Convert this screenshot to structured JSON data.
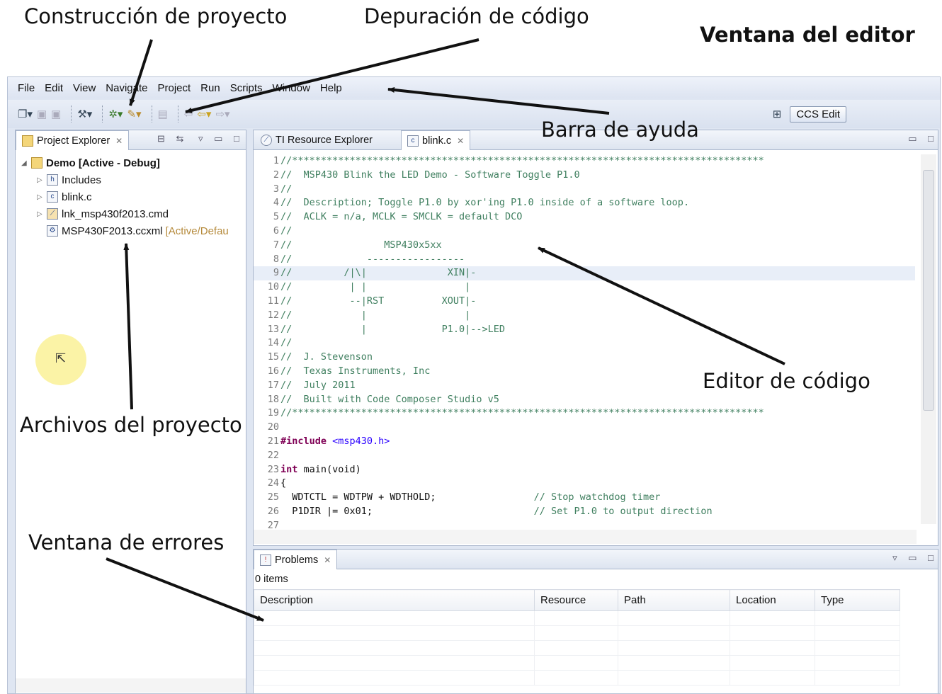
{
  "annotations": {
    "build": "Construcción de proyecto",
    "debug": "Depuración de código",
    "editor_window": "Ventana del editor",
    "help_bar": "Barra de ayuda",
    "code_editor": "Editor de código",
    "project_files": "Archivos del proyecto",
    "error_window": "Ventana de errores"
  },
  "menubar": [
    "File",
    "Edit",
    "View",
    "Navigate",
    "Project",
    "Run",
    "Scripts",
    "Window",
    "Help"
  ],
  "toolbar": {
    "perspective_label": "CCS Edit"
  },
  "project_explorer": {
    "title": "Project Explorer",
    "tree": [
      {
        "label": "Demo  [Active - Debug]",
        "icon": "project-folder-icon"
      },
      {
        "label": "Includes",
        "icon": "includes-icon"
      },
      {
        "label": "blink.c",
        "icon": "c-file-icon"
      },
      {
        "label": "lnk_msp430f2013.cmd",
        "icon": "cmd-file-icon"
      },
      {
        "label": "MSP430F2013.ccxml",
        "decor": "[Active/Defau",
        "icon": "ccxml-file-icon"
      }
    ]
  },
  "editor": {
    "tabs": [
      "TI Resource Explorer",
      "blink.c"
    ],
    "lines": [
      "//**********************************************************************************",
      "//  MSP430 Blink the LED Demo - Software Toggle P1.0",
      "//",
      "//  Description; Toggle P1.0 by xor'ing P1.0 inside of a software loop.",
      "//  ACLK = n/a, MCLK = SMCLK = default DCO",
      "//",
      "//                MSP430x5xx",
      "//             -----------------",
      "//         /|\\|              XIN|-",
      "//          | |                 |",
      "//          --|RST          XOUT|-",
      "//            |                 |",
      "//            |             P1.0|-->LED",
      "//",
      "//  J. Stevenson",
      "//  Texas Instruments, Inc",
      "//  July 2011",
      "//  Built with Code Composer Studio v5",
      "//**********************************************************************************",
      "",
      "#include <msp430.h>",
      "",
      "int main(void)",
      "{",
      "  WDTCTL = WDTPW + WDTHOLD;                 // Stop watchdog timer",
      "  P1DIR |= 0x01;                            // Set P1.0 to output direction",
      ""
    ]
  },
  "problems": {
    "title": "Problems",
    "count": "0 items",
    "columns": [
      "Description",
      "Resource",
      "Path",
      "Location",
      "Type"
    ]
  }
}
